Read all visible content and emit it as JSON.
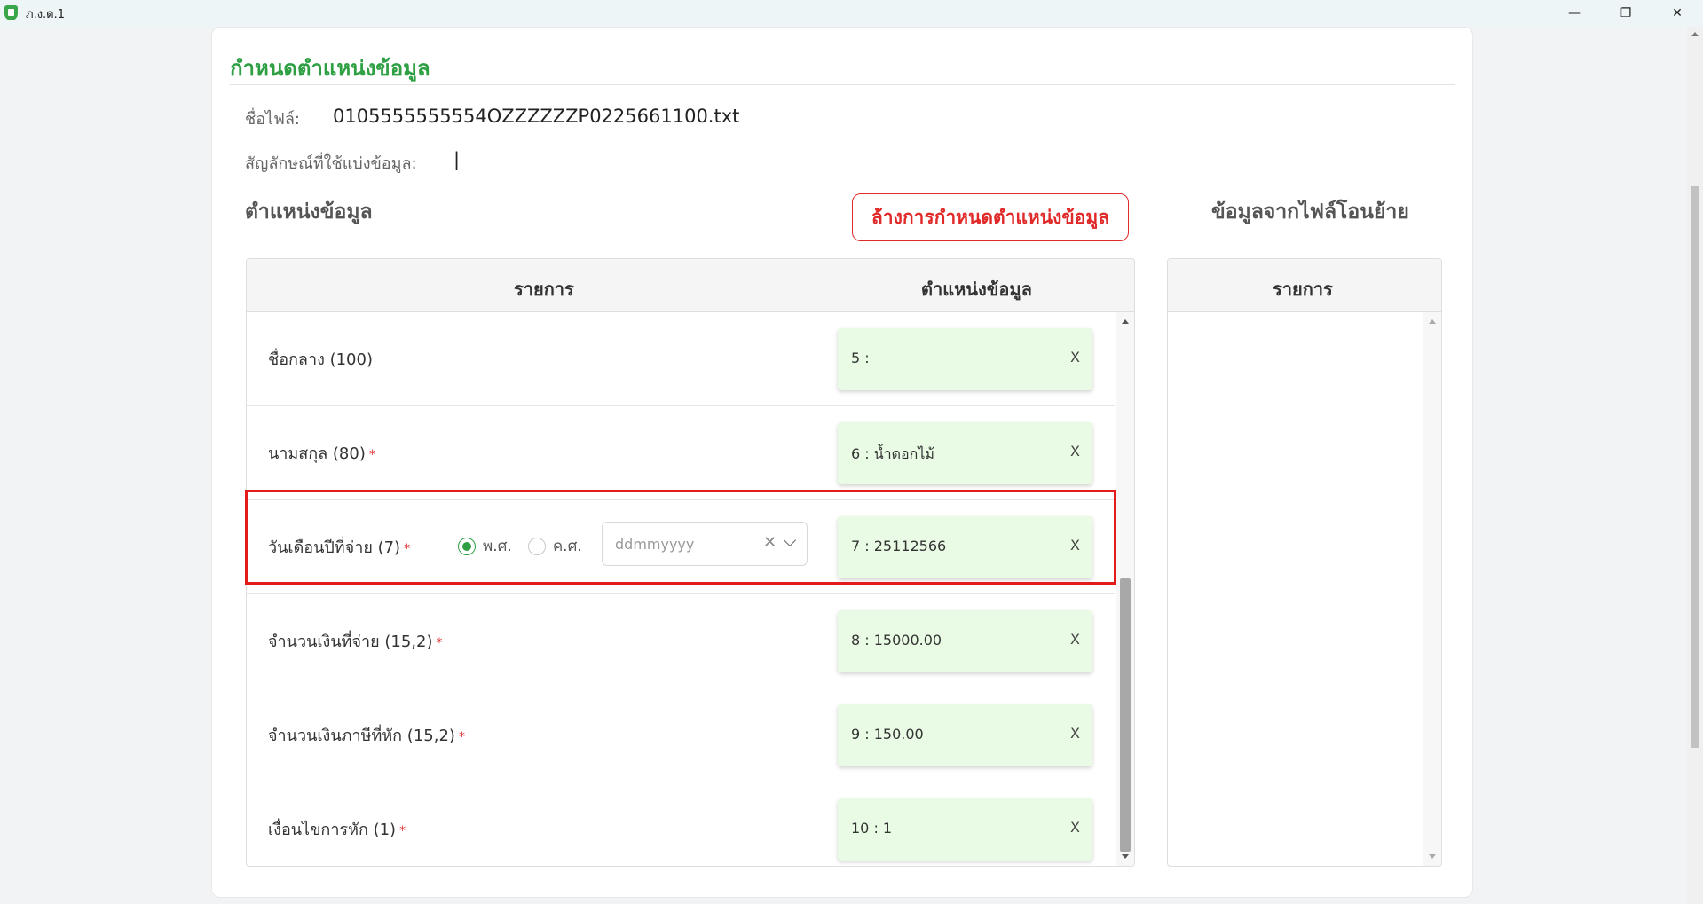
{
  "window": {
    "title": "ภ.ง.ด.1",
    "minimize": "—",
    "restore": "❐",
    "close": "✕"
  },
  "header": {
    "title": "กำหนดตำแหน่งข้อมูล"
  },
  "file": {
    "label": "ชื่อไฟล์:",
    "value": "0105555555554OZZZZZZP0225661100.txt"
  },
  "delimiter": {
    "label": "สัญลักษณ์ที่ใช้แบ่งข้อมูล:",
    "value": "|"
  },
  "positions_section": {
    "title": "ตำแหน่งข้อมูล",
    "clear_button": "ล้างการกำหนดตำแหน่งข้อมูล",
    "col_item": "รายการ",
    "col_position": "ตำแหน่งข้อมูล"
  },
  "source_section": {
    "title": "ข้อมูลจากไฟล์โอนย้าย",
    "col_item": "รายการ"
  },
  "rows": [
    {
      "label": "ชื่อกลาง (100)",
      "required": "",
      "position": "5 :",
      "remove": "X"
    },
    {
      "label": "นามสกุล (80)",
      "required": "*",
      "position": "6 : น้ำดอกไม้",
      "remove": "X"
    },
    {
      "label": "วันเดือนปีที่จ่าย (7)",
      "required": "*",
      "position": "7 : 25112566",
      "remove": "X",
      "era_options": [
        {
          "label": "พ.ศ.",
          "selected": true
        },
        {
          "label": "ค.ศ.",
          "selected": false
        }
      ],
      "date_format_placeholder": "ddmmyyyy",
      "clear_symbol": "✕"
    },
    {
      "label": "จำนวนเงินที่จ่าย (15,2)",
      "required": "*",
      "position": "8 : 15000.00",
      "remove": "X"
    },
    {
      "label": "จำนวนเงินภาษีที่หัก (15,2)",
      "required": "*",
      "position": "9 : 150.00",
      "remove": "X"
    },
    {
      "label": "เงื่อนไขการหัก (1)",
      "required": "*",
      "position": "10 : 1",
      "remove": "X"
    }
  ],
  "colors": {
    "accent": "#2ea043",
    "danger": "#e02a2a",
    "chip_bg": "#e9fbe4"
  }
}
